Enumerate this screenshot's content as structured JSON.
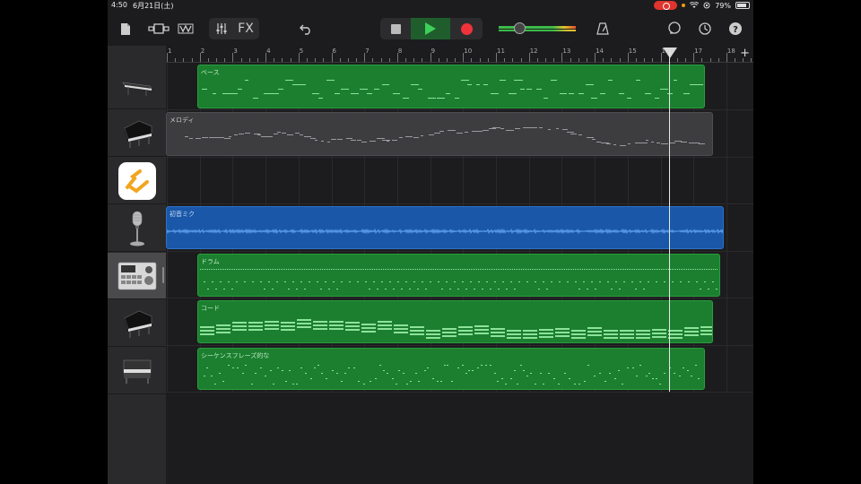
{
  "status": {
    "time": "4:50",
    "date": "6月21日(土)",
    "battery": "79%"
  },
  "toolbar": {
    "fx_label": "FX"
  },
  "ruler": {
    "bars": [
      "1",
      "2",
      "3",
      "4",
      "5",
      "6",
      "7",
      "8",
      "9",
      "10",
      "11",
      "12",
      "13",
      "14",
      "15",
      "16",
      "17",
      "18"
    ]
  },
  "tracks": [
    {
      "name": "ベース",
      "instrument": "keyboard-synth-icon",
      "color": "green"
    },
    {
      "name": "メロディ",
      "instrument": "grand-piano-icon",
      "color": "gray"
    },
    {
      "name": "",
      "instrument": "app-plugin-icon",
      "color": "none"
    },
    {
      "name": "初音ミク",
      "instrument": "microphone-icon",
      "color": "blue"
    },
    {
      "name": "ドラム",
      "instrument": "drum-machine-icon",
      "color": "green"
    },
    {
      "name": "コード",
      "instrument": "grand-piano-icon",
      "color": "green"
    },
    {
      "name": "シーケンスフレーズ的な",
      "instrument": "electric-piano-icon",
      "color": "green"
    }
  ],
  "add_track_label": "+",
  "colors": {
    "region_green": "#1b7f2f",
    "region_blue": "#1a57a8",
    "region_gray": "#3d3d40",
    "record": "#f0323b",
    "play": "#3ed05a"
  }
}
